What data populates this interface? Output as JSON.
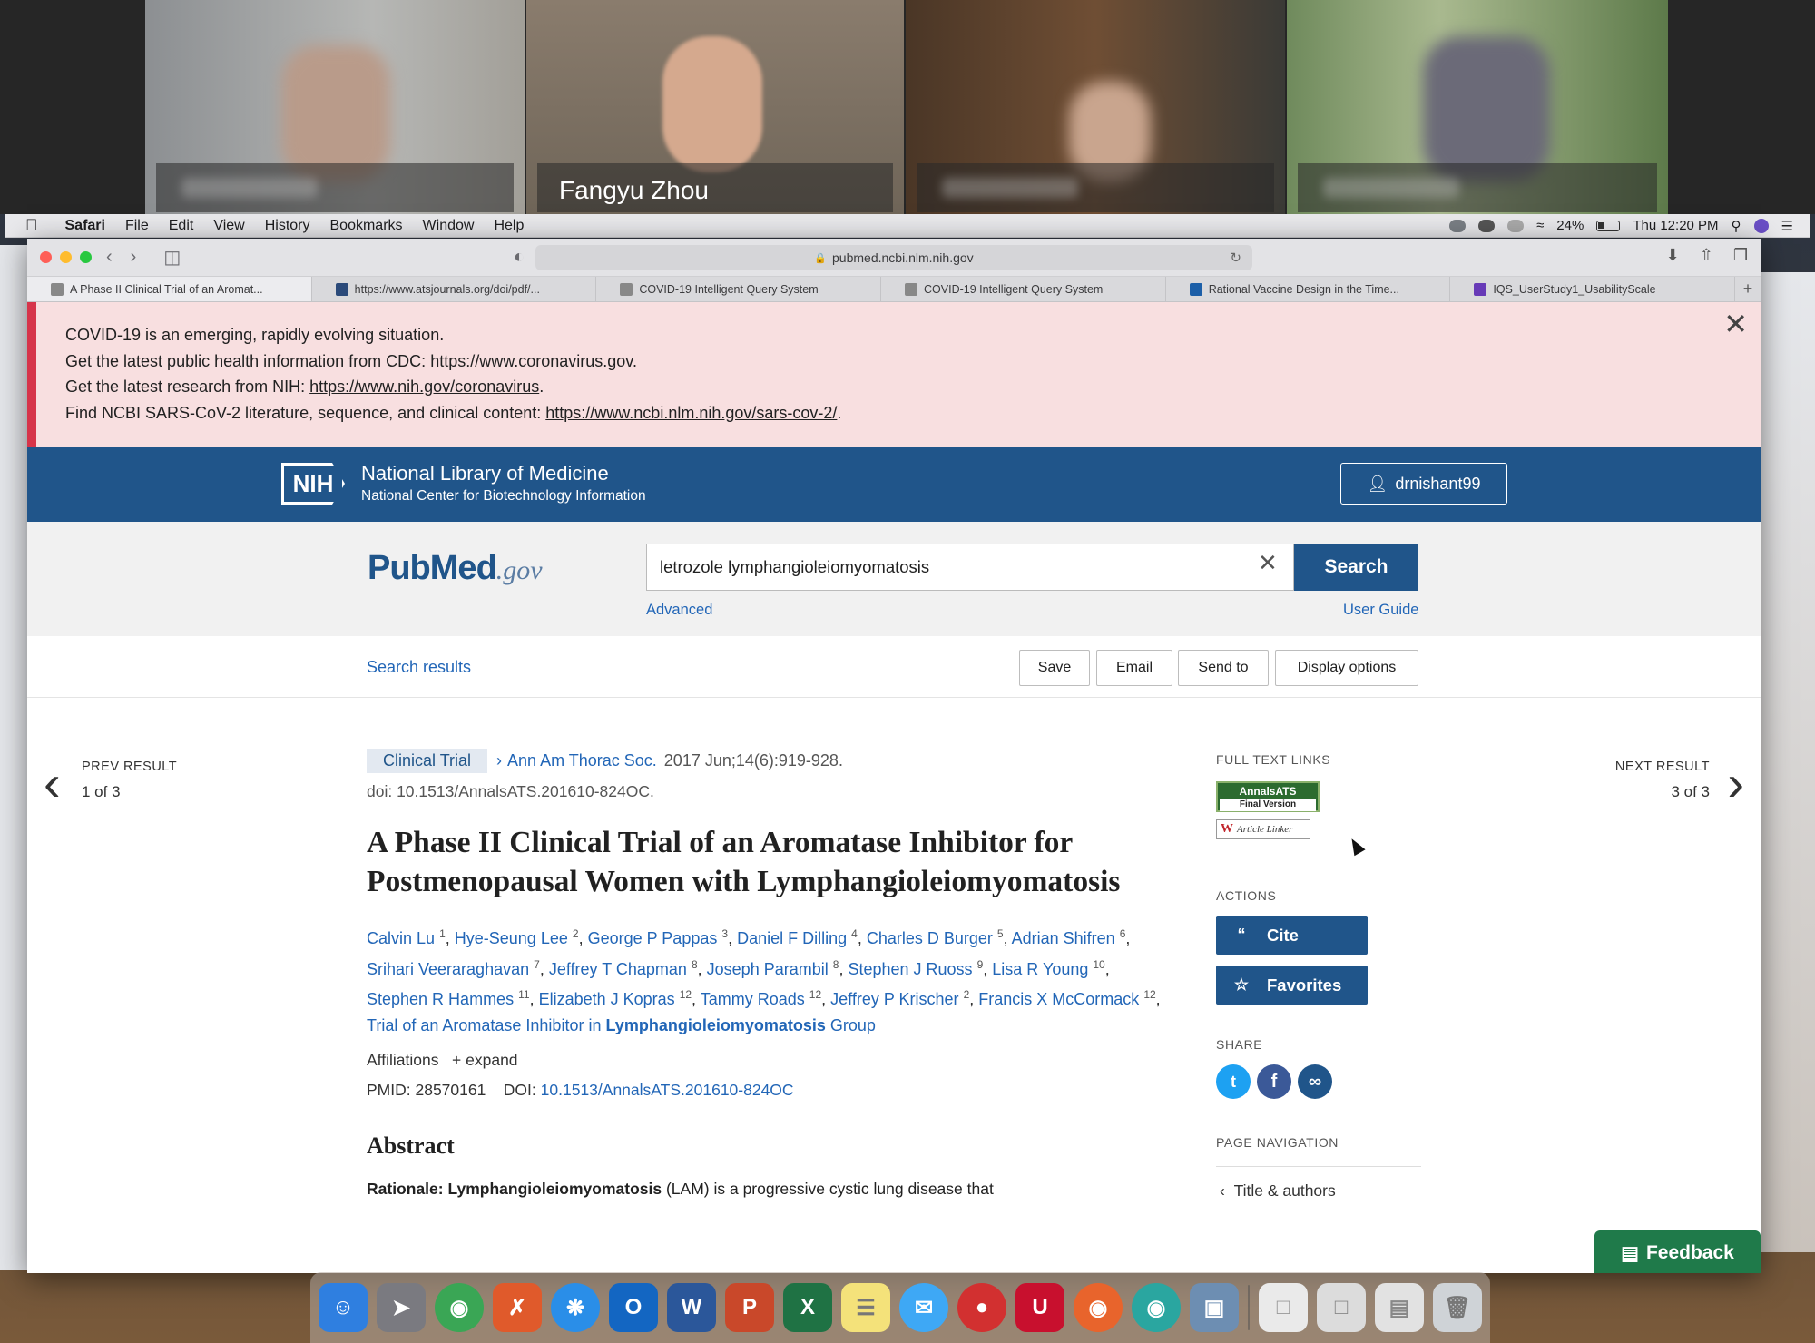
{
  "video": {
    "participants": [
      {
        "name": ""
      },
      {
        "name": "Fangyu Zhou"
      },
      {
        "name": ""
      },
      {
        "name": ""
      }
    ]
  },
  "menubar": {
    "app": "Safari",
    "items": [
      "File",
      "Edit",
      "View",
      "History",
      "Bookmarks",
      "Window",
      "Help"
    ],
    "battery": "24%",
    "clock": "Thu 12:20 PM"
  },
  "browser": {
    "url": "pubmed.ncbi.nlm.nih.gov",
    "tabs": [
      {
        "label": "A Phase II Clinical Trial of an Aromat..."
      },
      {
        "label": "https://www.atsjournals.org/doi/pdf/..."
      },
      {
        "label": "COVID-19 Intelligent Query System"
      },
      {
        "label": "COVID-19 Intelligent Query System"
      },
      {
        "label": "Rational Vaccine Design in the Time..."
      },
      {
        "label": "IQS_UserStudy1_UsabilityScale"
      }
    ]
  },
  "banner": {
    "line1": "COVID-19 is an emerging, rapidly evolving situation.",
    "line2_prefix": "Get the latest public health information from CDC: ",
    "line2_link": "https://www.coronavirus.gov",
    "line3_prefix": "Get the latest research from NIH: ",
    "line3_link": "https://www.nih.gov/coronavirus",
    "line4_prefix": "Find NCBI SARS-CoV-2 literature, sequence, and clinical content: ",
    "line4_link": "https://www.ncbi.nlm.nih.gov/sars-cov-2/",
    "period": ".",
    "close": "✕"
  },
  "nih": {
    "logo": "NIH",
    "title": "National Library of Medicine",
    "subtitle": "National Center for Biotechnology Information",
    "user": "drnishant99"
  },
  "search": {
    "logo_pub": "Pub",
    "logo_med": "Med",
    "logo_gov": ".gov",
    "query": "letrozole lymphangioleiomyomatosis",
    "button": "Search",
    "advanced": "Advanced",
    "user_guide": "User Guide"
  },
  "actions_bar": {
    "search_results": "Search results",
    "save": "Save",
    "email": "Email",
    "send_to": "Send to",
    "display_options": "Display options"
  },
  "nav": {
    "prev_label": "PREV RESULT",
    "prev_count": "1 of 3",
    "next_label": "NEXT RESULT",
    "next_count": "3 of 3"
  },
  "article": {
    "type": "Clinical Trial",
    "journal": "Ann Am Thorac Soc.",
    "citation": "2017 Jun;14(6):919-928.",
    "doi_line": "doi: 10.1513/AnnalsATS.201610-824OC.",
    "title": "A Phase II Clinical Trial of an Aromatase Inhibitor for Postmenopausal Women with Lymphangioleiomyomatosis",
    "authors": [
      {
        "name": "Calvin Lu",
        "aff": "1"
      },
      {
        "name": "Hye-Seung Lee",
        "aff": "2"
      },
      {
        "name": "George P Pappas",
        "aff": "3"
      },
      {
        "name": "Daniel F Dilling",
        "aff": "4"
      },
      {
        "name": "Charles D Burger",
        "aff": "5"
      },
      {
        "name": "Adrian Shifren",
        "aff": "6"
      },
      {
        "name": "Srihari Veeraraghavan",
        "aff": "7"
      },
      {
        "name": "Jeffrey T Chapman",
        "aff": "8"
      },
      {
        "name": "Joseph Parambil",
        "aff": "8"
      },
      {
        "name": "Stephen J Ruoss",
        "aff": "9"
      },
      {
        "name": "Lisa R Young",
        "aff": "10"
      },
      {
        "name": "Stephen R Hammes",
        "aff": "11"
      },
      {
        "name": "Elizabeth J Kopras",
        "aff": "12"
      },
      {
        "name": "Tammy Roads",
        "aff": "12"
      },
      {
        "name": "Jeffrey P Krischer",
        "aff": "2"
      },
      {
        "name": "Francis X McCormack",
        "aff": "12"
      }
    ],
    "group_prefix": "Trial of an Aromatase Inhibitor in",
    "group_bold": "Lymphangioleiomyomatosis",
    "group_suffix": "Group",
    "affiliations": "Affiliations",
    "expand": "+ expand",
    "pmid_label": "PMID: 28570161",
    "doi_label": "DOI:",
    "doi": "10.1513/AnnalsATS.201610-824OC",
    "abstract_heading": "Abstract",
    "abstract_bold": "Rationale: Lymphangioleiomyomatosis",
    "abstract_text": " (LAM) is a progressive cystic lung disease that"
  },
  "sidebar": {
    "full_text_links": "FULL TEXT LINKS",
    "ats_top": "AnnalsATS",
    "ats_bottom": "Final Version",
    "article_linker": "Article Linker",
    "actions": "ACTIONS",
    "cite": "Cite",
    "favorites": "Favorites",
    "share": "SHARE",
    "page_navigation": "PAGE NAVIGATION",
    "title_authors": "Title & authors"
  },
  "feedback": "Feedback"
}
